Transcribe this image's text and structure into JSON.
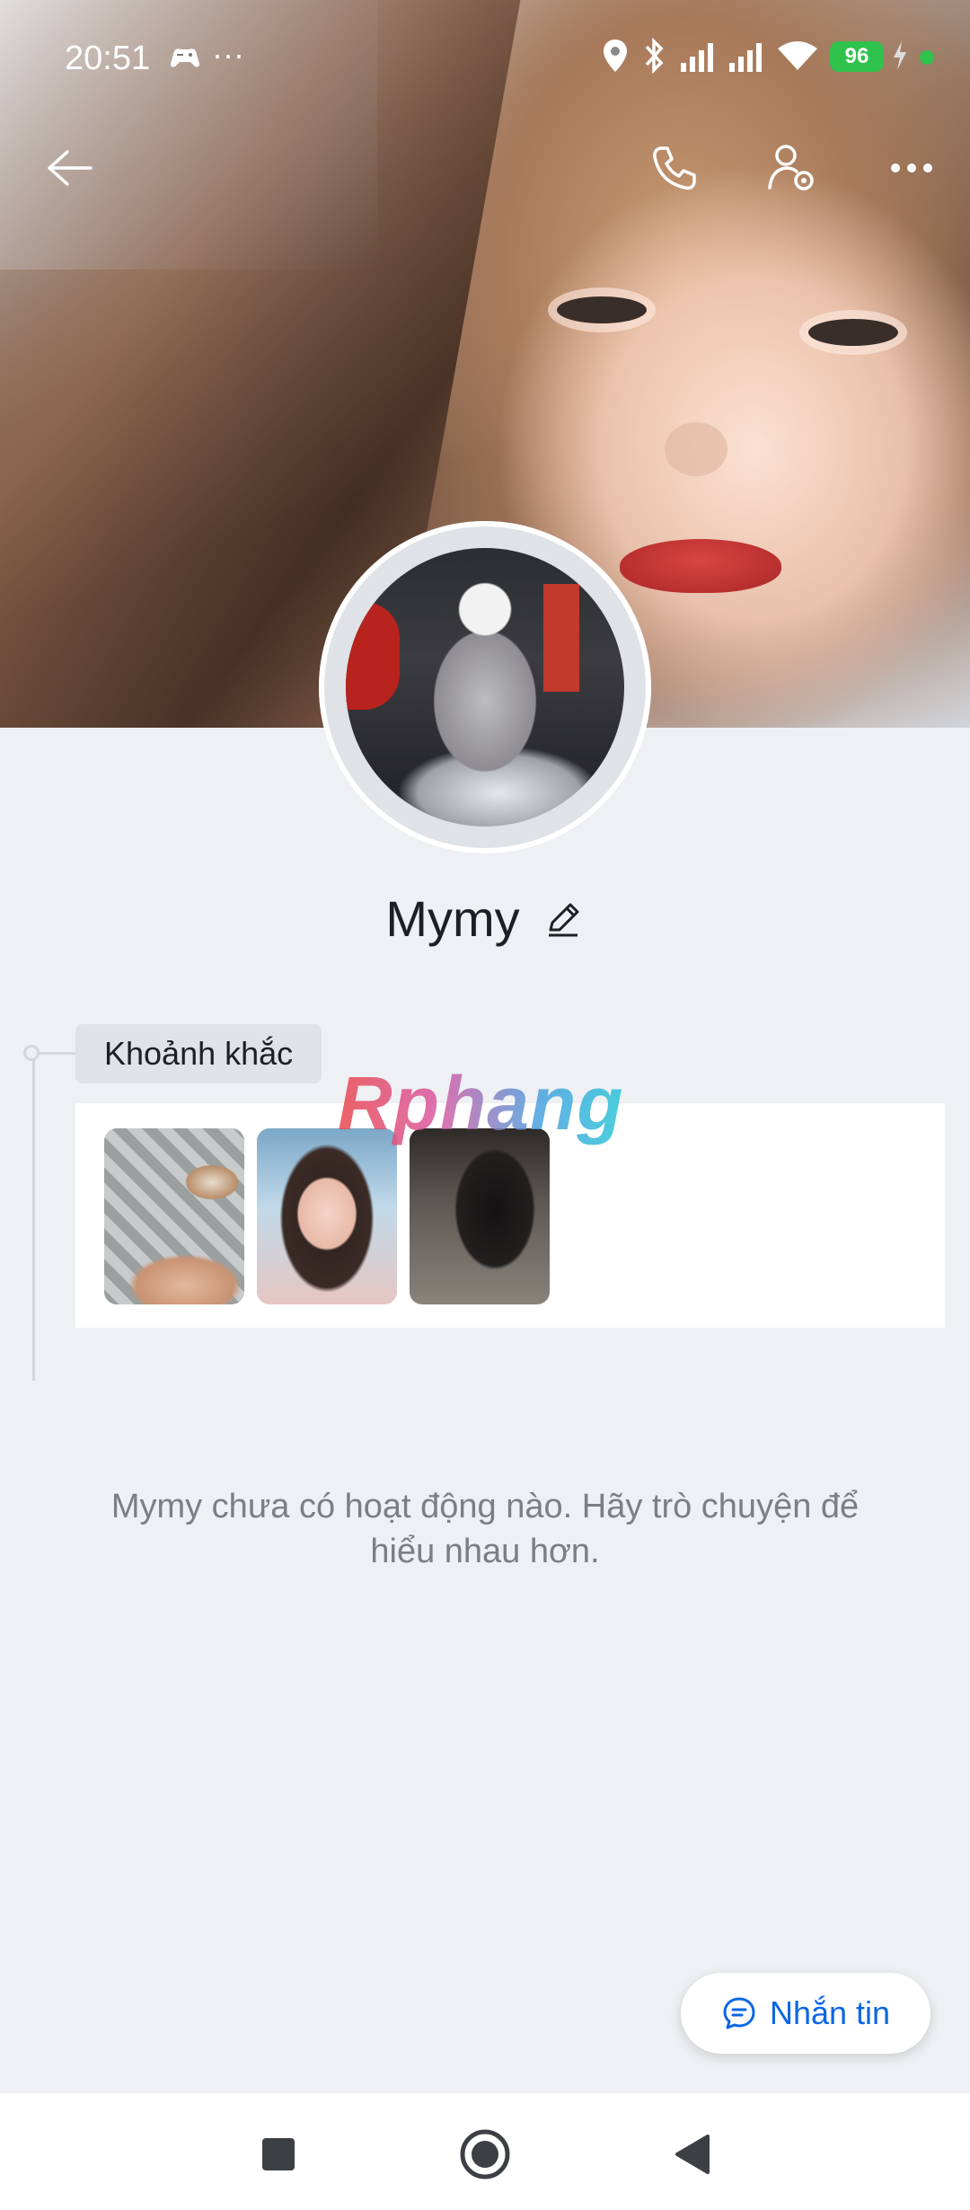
{
  "status_bar": {
    "time": "20:51",
    "battery": "96",
    "icons": [
      "gamepad-icon",
      "more-notifications-icon",
      "location-icon",
      "bluetooth-icon",
      "signal-1-icon",
      "signal-2-icon",
      "wifi-icon",
      "battery-icon",
      "charging-icon"
    ]
  },
  "header": {
    "back_icon": "arrow-left-icon",
    "call_icon": "phone-icon",
    "settings_icon": "user-settings-icon",
    "more_icon": "more-horizontal-icon"
  },
  "profile": {
    "name": "Mymy",
    "edit_icon": "pencil-icon"
  },
  "moments": {
    "label": "Khoảnh khắc",
    "thumbnails": 3
  },
  "watermark": "Rphang",
  "empty_message": "Mymy chưa có hoạt động nào. Hãy trò chuyện để hiểu nhau hơn.",
  "message_button": {
    "label": "Nhắn tin",
    "icon": "chat-bubble-icon",
    "color": "#0b66e4"
  },
  "system_nav": {
    "recents_icon": "square-icon",
    "home_icon": "circle-home-icon",
    "back_icon": "triangle-back-icon"
  },
  "colors": {
    "background": "#eef0f3",
    "battery": "#2fc24c",
    "text_primary": "#1e1f22",
    "text_muted": "#7a7f86"
  }
}
